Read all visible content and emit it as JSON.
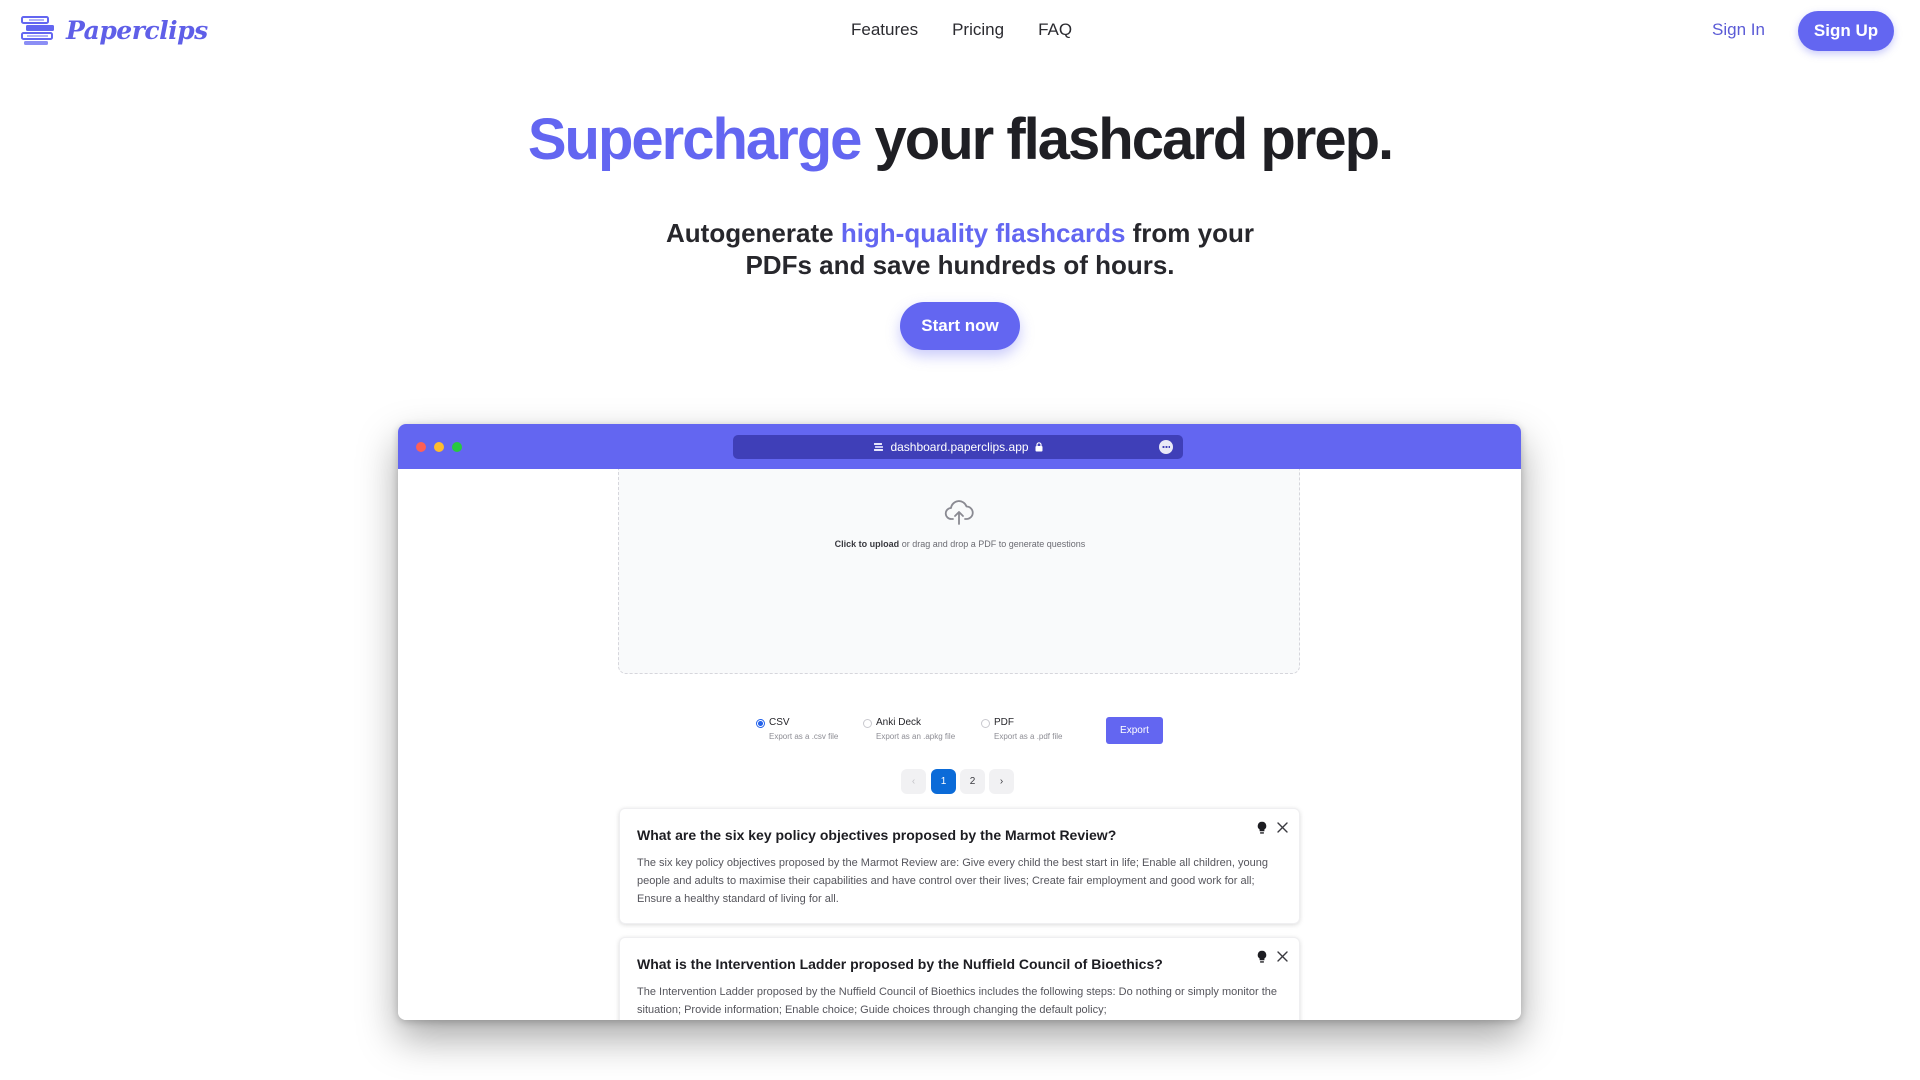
{
  "brand": {
    "name": "Paperclips",
    "color": "#6366f1"
  },
  "nav": {
    "links": [
      "Features",
      "Pricing",
      "FAQ"
    ],
    "signin_label": "Sign In",
    "signup_label": "Sign Up"
  },
  "hero": {
    "title_accent": "Supercharge",
    "title_rest": " your flashcard prep.",
    "subtitle_pre": "Autogenerate ",
    "subtitle_accent": "high-quality flashcards",
    "subtitle_post": " from your",
    "subtitle_line2": "PDFs and save hundreds of hours.",
    "cta_label": "Start now"
  },
  "mockup": {
    "url": "dashboard.paperclips.app",
    "upload": {
      "bold": "Click to upload",
      "rest": " or drag and drop a PDF to generate questions"
    },
    "export_options": [
      {
        "label": "CSV",
        "hint": "Export as a .csv file",
        "checked": true
      },
      {
        "label": "Anki Deck",
        "hint": "Export as an .apkg file",
        "checked": false
      },
      {
        "label": "PDF",
        "hint": "Export as a .pdf file",
        "checked": false
      }
    ],
    "export_label": "Export",
    "pagination": {
      "prev": "‹",
      "pages": [
        "1",
        "2"
      ],
      "active": "1",
      "next": "›"
    },
    "cards": [
      {
        "question": "What are the six key policy objectives proposed by the Marmot Review?",
        "answer": "The six key policy objectives proposed by the Marmot Review are: Give every child the best start in life; Enable all children, young people and adults to maximise their capabilities and have control over their lives; Create fair employment and good work for all; Ensure a healthy standard of living for all."
      },
      {
        "question": "What is the Intervention Ladder proposed by the Nuffield Council of Bioethics?",
        "answer": "The Intervention Ladder proposed by the Nuffield Council of Bioethics includes the following steps: Do nothing or simply monitor the situation; Provide information; Enable choice; Guide choices through changing the default policy;"
      }
    ]
  }
}
